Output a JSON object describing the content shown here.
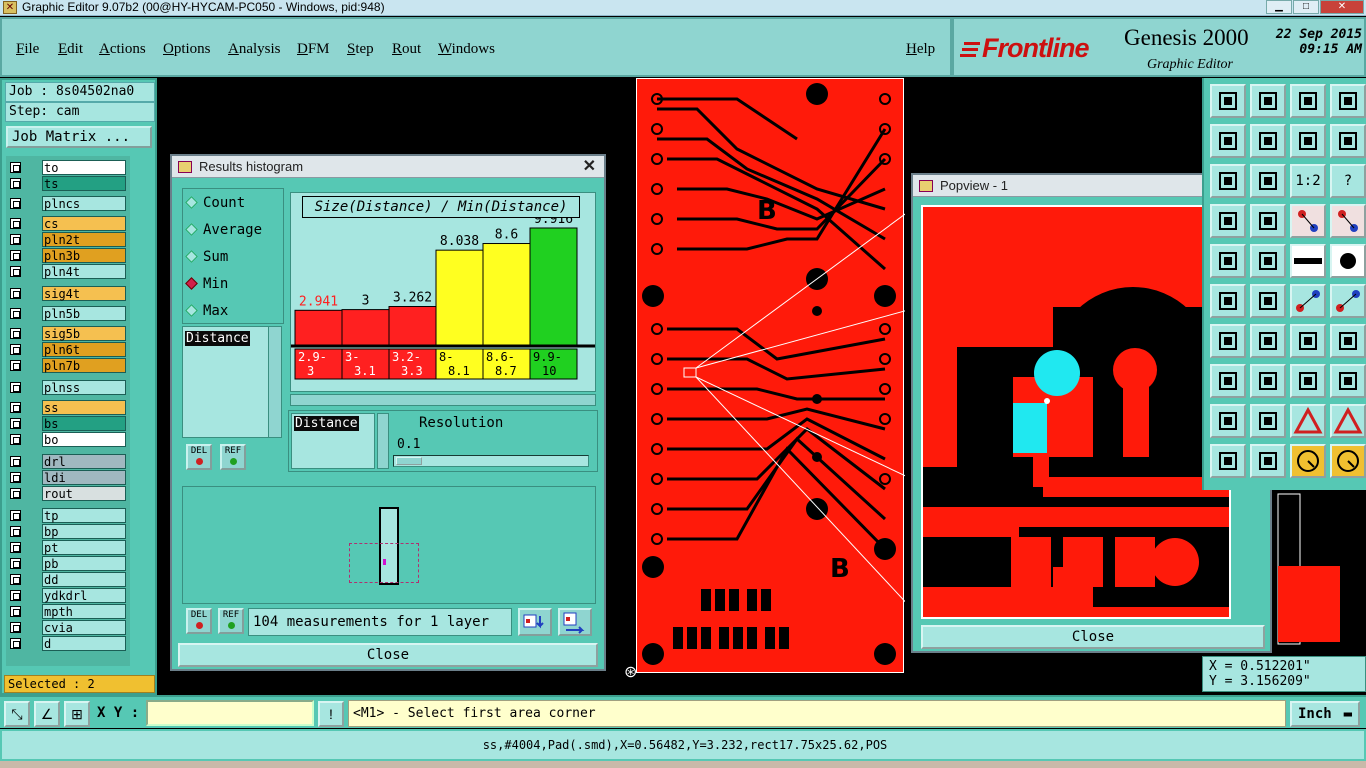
{
  "window": {
    "title": "Graphic Editor 9.07b2 (00@HY-HYCAM-PC050 - Windows, pid:948)",
    "icon": "x-app-icon"
  },
  "menu": {
    "items": [
      "File",
      "Edit",
      "Actions",
      "Options",
      "Analysis",
      "DFM",
      "Step",
      "Rout",
      "Windows"
    ],
    "help": "Help"
  },
  "brand": {
    "logo": "Frontline",
    "product": "Genesis 2000",
    "subtitle": "Graphic Editor",
    "date": "22 Sep 2015",
    "time": "09:15 AM",
    "logo_color": "#cc1010"
  },
  "left": {
    "job": "Job : 8s04502na0",
    "step": "Step: cam",
    "job_matrix": "Job Matrix ...",
    "layers": [
      {
        "name": "to",
        "color": "#ffffff"
      },
      {
        "name": "ts",
        "color": "#23a083"
      },
      {
        "name": "plncs",
        "color": "#a7e6e0"
      },
      {
        "name": "cs",
        "color": "#f5c050"
      },
      {
        "name": "pln2t",
        "color": "#e0a020"
      },
      {
        "name": "pln3b",
        "color": "#e0a020"
      },
      {
        "name": "pln4t",
        "color": "#a7e6e0"
      },
      {
        "name": "sig4t",
        "color": "#f5c050"
      },
      {
        "name": "pln5b",
        "color": "#a7e6e0"
      },
      {
        "name": "sig5b",
        "color": "#f5c050"
      },
      {
        "name": "pln6t",
        "color": "#e0a020"
      },
      {
        "name": "pln7b",
        "color": "#e0a020"
      },
      {
        "name": "plnss",
        "color": "#a7e6e0"
      },
      {
        "name": "ss",
        "color": "#f5c050"
      },
      {
        "name": "bs",
        "color": "#23a083"
      },
      {
        "name": "bo",
        "color": "#ffffff"
      },
      {
        "name": "drl",
        "color": "#a0b8c0"
      },
      {
        "name": "ldi",
        "color": "#a0b8c0"
      },
      {
        "name": "rout",
        "color": "#d8e0e0"
      },
      {
        "name": "tp",
        "color": "#a7e6e0"
      },
      {
        "name": "bp",
        "color": "#a7e6e0"
      },
      {
        "name": "pt",
        "color": "#a7e6e0"
      },
      {
        "name": "pb",
        "color": "#a7e6e0"
      },
      {
        "name": "dd",
        "color": "#a7e6e0"
      },
      {
        "name": "ydkdrl",
        "color": "#a7e6e0"
      },
      {
        "name": "mpth",
        "color": "#a7e6e0"
      },
      {
        "name": "cvia",
        "color": "#a7e6e0"
      },
      {
        "name": "d",
        "color": "#a7e6e0"
      }
    ],
    "selected": "Selected : 2"
  },
  "histogram": {
    "title": "Results histogram",
    "modes": [
      "Count",
      "Average",
      "Sum",
      "Min",
      "Max"
    ],
    "selected_mode": "Min",
    "list_item": "Distance",
    "chart_title": "Size(Distance) / Min(Distance)",
    "bins": [
      {
        "value": "2.941",
        "range": "2.9-3",
        "color": "#ff2020",
        "valcolor": "#ff2020"
      },
      {
        "value": "3",
        "range": "3-3.1",
        "color": "#ff2020",
        "valcolor": "#000"
      },
      {
        "value": "3.262",
        "range": "3.2-3.3",
        "color": "#ff2020",
        "valcolor": "#000"
      },
      {
        "value": "8.038",
        "range": "8-8.1",
        "color": "#ffff20",
        "valcolor": "#000"
      },
      {
        "value": "8.6",
        "range": "8.6-8.7",
        "color": "#ffff20",
        "valcolor": "#000"
      },
      {
        "value": "9.916",
        "range": "9.9-10",
        "color": "#20d020",
        "valcolor": "#000"
      }
    ],
    "resolution_field": "Distance",
    "resolution_label": "Resolution",
    "resolution_value": "0.1",
    "del_label": "DEL",
    "ref_label": "REF",
    "measurements": "104 measurements for 1 layer",
    "close": "Close"
  },
  "popview": {
    "title": "Popview - 1",
    "close": "Close"
  },
  "toolbox": {
    "scale_label": "1:2",
    "help_label": "?"
  },
  "coords": {
    "x": "X = 0.512201\"",
    "y": "Y = 3.156209\""
  },
  "cmd": {
    "xy_label": "X Y :",
    "xy_value": "",
    "prompt": "<M1> - Select first area corner",
    "units": "Inch"
  },
  "status": "ss,#4004,Pad(.smd),X=0.56482,Y=3.232,rect17.75x25.62,POS",
  "chart_data": {
    "type": "bar",
    "title": "Size(Distance) / Min(Distance)",
    "categories": [
      "2.9-3",
      "3-3.1",
      "3.2-3.3",
      "8-8.1",
      "8.6-8.7",
      "9.9-10"
    ],
    "values": [
      2.941,
      3,
      3.262,
      8.038,
      8.6,
      9.916
    ],
    "colors": [
      "#ff2020",
      "#ff2020",
      "#ff2020",
      "#ffff20",
      "#ffff20",
      "#20d020"
    ]
  }
}
